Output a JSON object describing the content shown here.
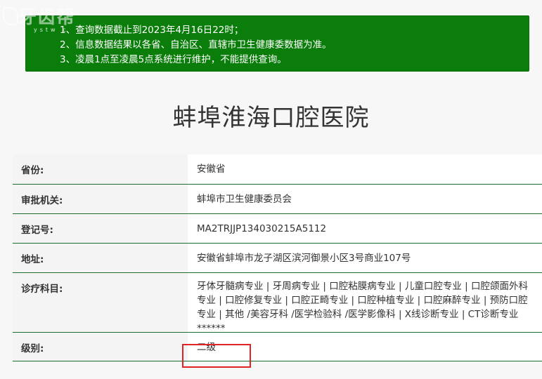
{
  "watermark": {
    "logo_text": "牙齿帮",
    "logo_sub": "ystw c"
  },
  "notice": {
    "lines": [
      "1、查询数据截止到2023年4月16日22时；",
      "2、信息数据结果以各省、自治区、直辖市卫生健康委数据为准。",
      "3、凌晨1点至凌晨5点系统进行维护，不能提供查询。"
    ],
    "background_color": "#0a7d0a"
  },
  "hospital": {
    "name": "蚌埠淮海口腔医院"
  },
  "details": {
    "province": {
      "label": "省份:",
      "value": "安徽省"
    },
    "authority": {
      "label": "审批机关:",
      "value": "蚌埠市卫生健康委员会"
    },
    "reg_no": {
      "label": "登记号:",
      "value": "MA2TRJJP134030215A5112"
    },
    "address": {
      "label": "地址:",
      "value": "安徽省蚌埠市龙子湖区滨河御景小区3号商业107号"
    },
    "departments": {
      "label": "诊疗科目:",
      "value": "牙体牙髓病专业 | 牙周病专业 | 口腔粘膜病专业 | 儿童口腔专业 | 口腔颌面外科专业 | 口腔修复专业 | 口腔正畸专业 | 口腔种植专业 | 口腔麻醉专业 | 预防口腔专业 | 其他 /美容牙科 /医学检验科 /医学影像科 | X线诊断专业 | CT诊断专业******"
    },
    "grade": {
      "label": "级别:",
      "value": "二级"
    }
  },
  "highlight_color": "#e02424"
}
